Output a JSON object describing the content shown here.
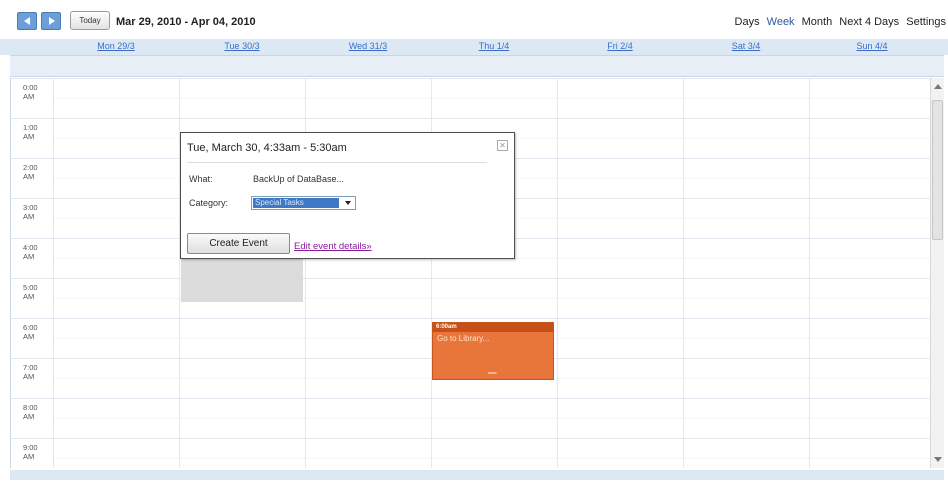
{
  "toolbar": {
    "today_label": "Today",
    "date_range": "Mar 29, 2010 - Apr 04, 2010",
    "views": [
      {
        "label": "Days",
        "active": false
      },
      {
        "label": "Week",
        "active": true
      },
      {
        "label": "Month",
        "active": false
      },
      {
        "label": "Next 4 Days",
        "active": false
      },
      {
        "label": "Settings",
        "active": false
      }
    ]
  },
  "days": [
    "Mon 29/3",
    "Tue 30/3",
    "Wed 31/3",
    "Thu 1/4",
    "Fri 2/4",
    "Sat 3/4",
    "Sun 4/4"
  ],
  "hours": [
    "0:00 AM",
    "1:00 AM",
    "2:00 AM",
    "3:00 AM",
    "4:00 AM",
    "5:00 AM",
    "6:00 AM",
    "7:00 AM",
    "8:00 AM",
    "9:00 AM"
  ],
  "popup": {
    "title": "Tue, March 30, 4:33am - 5:30am",
    "close_icon": "close-icon",
    "what_label": "What:",
    "what_value": "BackUp of DataBase...",
    "category_label": "Category:",
    "category_value": "Special Tasks",
    "create_button": "Create Event",
    "edit_link": "Edit event details»"
  },
  "event": {
    "time": "6:00am",
    "title": "Go to Library...",
    "grip": "===",
    "color": "#e8763b"
  },
  "colors": {
    "accent": "#3a6ec9",
    "header_bg": "#dde8f5",
    "selection_bg": "#d9d9d9"
  }
}
